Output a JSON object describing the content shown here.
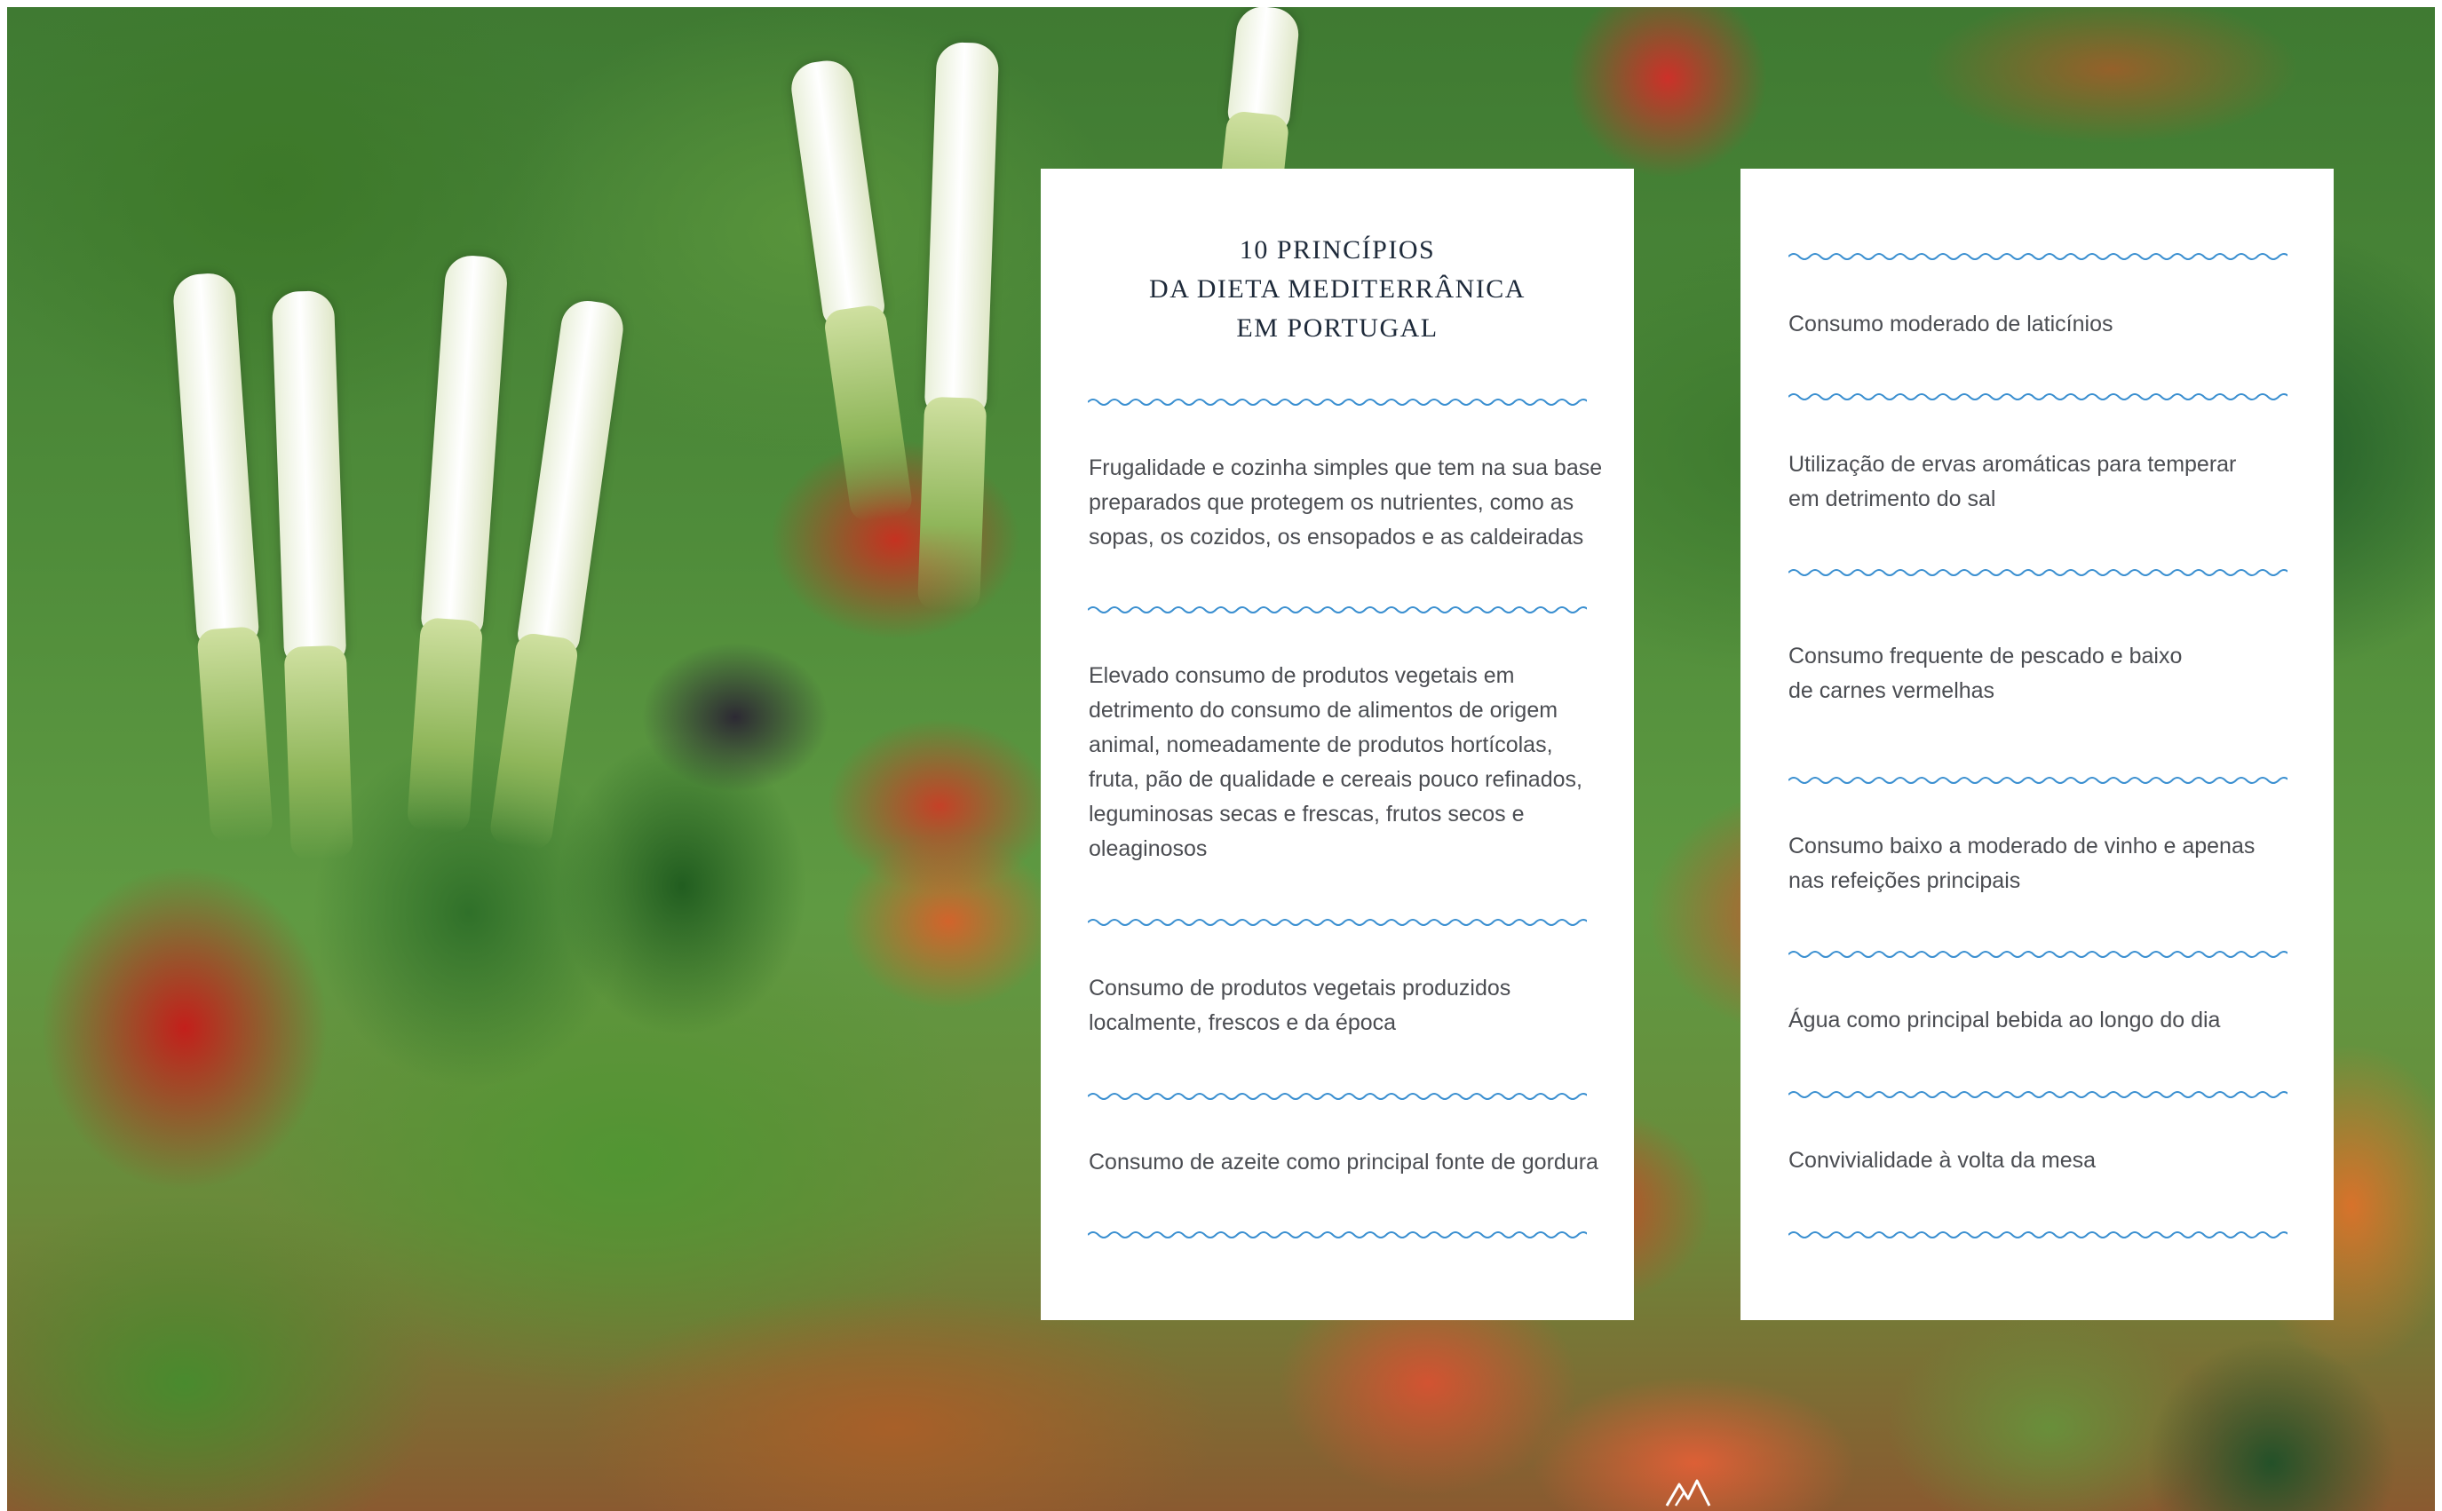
{
  "background": {
    "description_icon": "produce-market-photo"
  },
  "left_card": {
    "title_lines": [
      "10 PRINCÍPIOS",
      "DA DIETA MEDITERRÂNICA",
      "EM PORTUGAL"
    ],
    "items": [
      "Frugalidade e cozinha simples que tem na sua base\npreparados que protegem os nutrientes, como as\nsopas, os cozidos, os ensopados e as caldeiradas",
      "Elevado consumo de produtos vegetais em\ndetrimento do consumo de alimentos de origem\nanimal, nomeadamente de produtos hortícolas,\nfruta, pão de qualidade e cereais pouco refinados,\nleguminosas secas e frescas, frutos secos e\noleaginosos",
      "Consumo de produtos vegetais produzidos\nlocalmente, frescos e da época",
      "Consumo de azeite como principal fonte de gordura"
    ]
  },
  "right_card": {
    "items": [
      "Consumo moderado de laticínios",
      "Utilização de ervas aromáticas para temperar\nem detrimento do sal",
      "Consumo frequente de pescado e baixo\n de carnes vermelhas",
      "Consumo baixo a moderado de vinho e apenas\nnas refeições principais",
      "Água como principal bebida ao longo do dia",
      "Convivialidade à volta da mesa"
    ]
  },
  "colors": {
    "wave": "#3a8fd0",
    "title": "#1e2a3a",
    "body_text": "#4b4d52",
    "card_bg": "#ffffff"
  },
  "icons": {
    "divider": "wavy-line",
    "logo": "mountain-logo-icon"
  }
}
